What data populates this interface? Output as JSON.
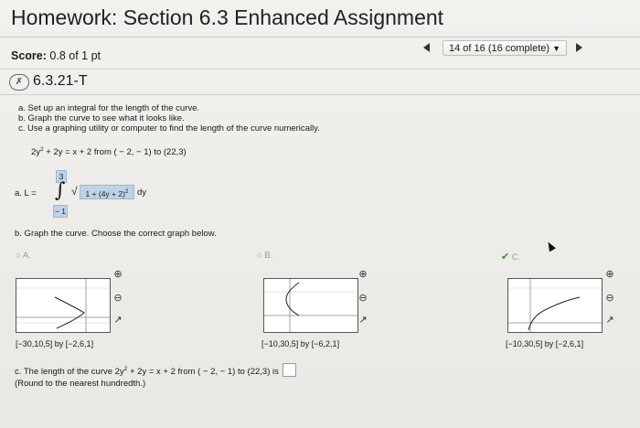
{
  "header": {
    "title": "Homework: Section 6.3 Enhanced Assignment",
    "score_label": "Score:",
    "score_value": "0.8 of 1 pt",
    "progress": "14 of 16 (16 complete)"
  },
  "question": {
    "id": "6.3.21-T",
    "instructions": [
      "a. Set up an integral for the length of the curve.",
      "b. Graph the curve to see what it looks like.",
      "c. Use a graphing utility or computer to find the length of the curve numerically."
    ],
    "equation_lhs": "2y",
    "equation_exp": "2",
    "equation_rest": " + 2y = x + 2 from ( − 2, − 1) to (22,3)",
    "part_a": {
      "label": "a. L =",
      "upper": "3",
      "lower": "− 1",
      "integrand": "1 + (4y + 2)",
      "integrand_exp": "2",
      "differential": "dy"
    },
    "part_b_prompt": "b. Graph the curve. Choose the correct graph below.",
    "options": [
      {
        "letter": "A.",
        "caption": "[−30,10,5] by [−2,6,1]"
      },
      {
        "letter": "B.",
        "caption": "[−10,30,5] by [−6,2,1]"
      },
      {
        "letter": "C.",
        "caption": "[−10,30,5] by [−2,6,1]"
      }
    ],
    "part_c_prefix": "c. The length of the curve 2y",
    "part_c_exp": "2",
    "part_c_suffix": " + 2y = x + 2 from ( − 2, − 1) to (22,3) is",
    "part_c_note": "(Round to the nearest hundredth.)"
  },
  "colors": {
    "answer_highlight": "#bfd3e8",
    "correct_check": "#3c8b2a"
  },
  "icons": [
    "zoom-in-icon",
    "zoom-out-icon",
    "popout-icon",
    "check-icon",
    "x-mark-icon"
  ]
}
